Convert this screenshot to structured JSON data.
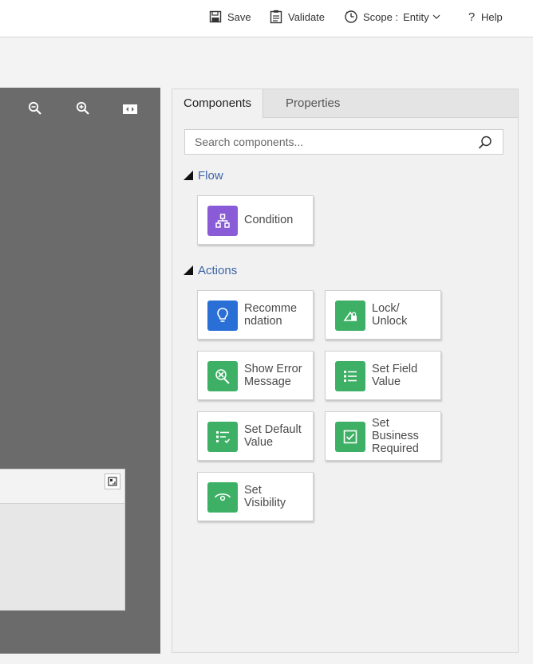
{
  "toolbar": {
    "save": "Save",
    "validate": "Validate",
    "scope_label": "Scope :",
    "scope_value": "Entity",
    "help": "Help"
  },
  "canvas": {
    "zoom_out_icon": "zoom-out-icon",
    "zoom_in_icon": "zoom-in-icon",
    "fit_icon": "fit-to-screen-icon"
  },
  "panel": {
    "tabs": [
      "Components",
      "Properties"
    ],
    "active_tab": "Components",
    "search_placeholder": "Search components...",
    "sections": [
      {
        "title": "Flow",
        "items": [
          {
            "label_line1": "Condition",
            "label_line2": "",
            "label_line3": "",
            "icon": "condition-icon",
            "color": "#8a5bd6"
          }
        ]
      },
      {
        "title": "Actions",
        "items": [
          {
            "label_line1": "Recomme",
            "label_line2": "ndation",
            "label_line3": "",
            "icon": "lightbulb-icon",
            "color": "#2a6fd6"
          },
          {
            "label_line1": "Lock/",
            "label_line2": "Unlock",
            "label_line3": "",
            "icon": "lock-unlock-icon",
            "color": "#3db065"
          },
          {
            "label_line1": "Show Error",
            "label_line2": "Message",
            "label_line3": "",
            "icon": "error-message-icon",
            "color": "#3db065"
          },
          {
            "label_line1": "Set Field",
            "label_line2": "Value",
            "label_line3": "",
            "icon": "set-field-value-icon",
            "color": "#3db065"
          },
          {
            "label_line1": "Set Default",
            "label_line2": "Value",
            "label_line3": "",
            "icon": "set-default-value-icon",
            "color": "#3db065"
          },
          {
            "label_line1": "Set",
            "label_line2": "Business",
            "label_line3": "Required",
            "icon": "checkbox-icon",
            "color": "#3db065"
          },
          {
            "label_line1": "Set",
            "label_line2": "Visibility",
            "label_line3": "",
            "icon": "eye-icon",
            "color": "#3db065"
          }
        ]
      }
    ]
  }
}
